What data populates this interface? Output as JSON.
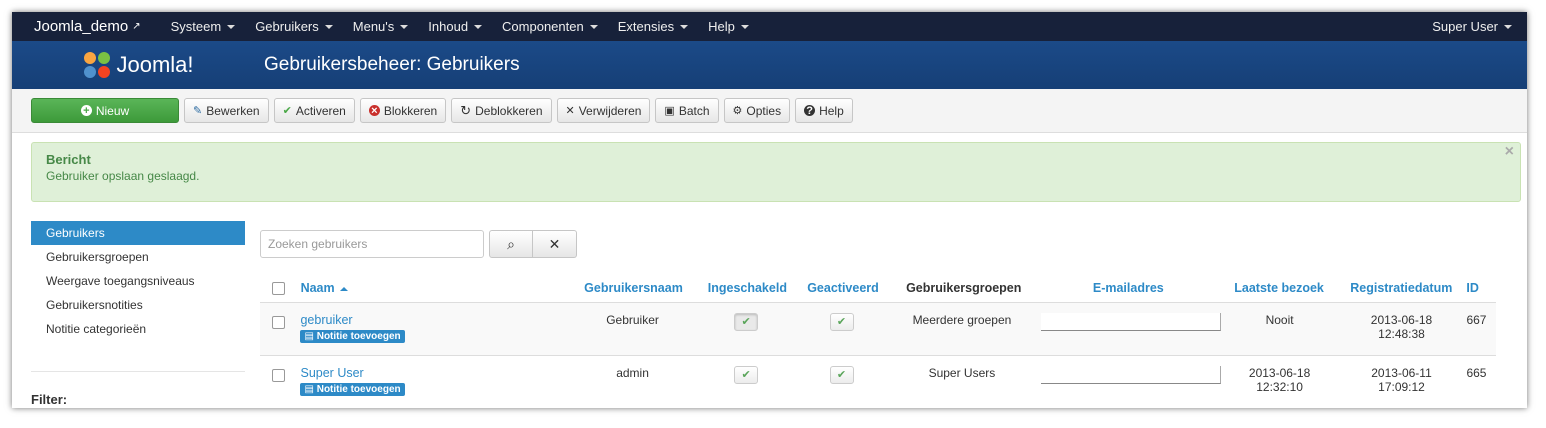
{
  "navbar": {
    "brand": "Joomla_demo",
    "menu": [
      "Systeem",
      "Gebruikers",
      "Menu's",
      "Inhoud",
      "Componenten",
      "Extensies",
      "Help"
    ],
    "user": "Super User"
  },
  "header": {
    "logo_text": "Joomla!",
    "title": "Gebruikersbeheer: Gebruikers"
  },
  "toolbar": {
    "new": "Nieuw",
    "edit": "Bewerken",
    "activate": "Activeren",
    "block": "Blokkeren",
    "unblock": "Deblokkeren",
    "delete": "Verwijderen",
    "batch": "Batch",
    "options": "Opties",
    "help": "Help"
  },
  "alert": {
    "title": "Bericht",
    "text": "Gebruiker opslaan geslaagd.",
    "close": "×"
  },
  "sidebar": {
    "items": [
      "Gebruikers",
      "Gebruikersgroepen",
      "Weergave toegangsniveaus",
      "Gebruikersnotities",
      "Notitie categorieën"
    ],
    "filter_label": "Filter:"
  },
  "search": {
    "placeholder": "Zoeken gebruikers"
  },
  "table": {
    "headers": {
      "name": "Naam",
      "username": "Gebruikersnaam",
      "enabled": "Ingeschakeld",
      "activated": "Geactiveerd",
      "groups": "Gebruikersgroepen",
      "email": "E-mailadres",
      "last_visit": "Laatste bezoek",
      "registered": "Registratiedatum",
      "id": "ID"
    },
    "rows": [
      {
        "name": "gebruiker",
        "note": "Notitie toevoegen",
        "username": "Gebruiker",
        "groups": "Meerdere groepen",
        "last_visit": "Nooit",
        "last_visit_time": "",
        "registered_date": "2013-06-18",
        "registered_time": "12:48:38",
        "id": "667"
      },
      {
        "name": "Super User",
        "note": "Notitie toevoegen",
        "username": "admin",
        "groups": "Super Users",
        "last_visit": "2013-06-18",
        "last_visit_time": "12:32:10",
        "registered_date": "2013-06-11",
        "registered_time": "17:09:12",
        "id": "665"
      }
    ]
  },
  "colors": {
    "navbar": "#17213a",
    "header": "#1b4a88",
    "accent": "#2d8ac7",
    "new_button": "#4aa847",
    "alert_bg": "#dff0d8"
  }
}
